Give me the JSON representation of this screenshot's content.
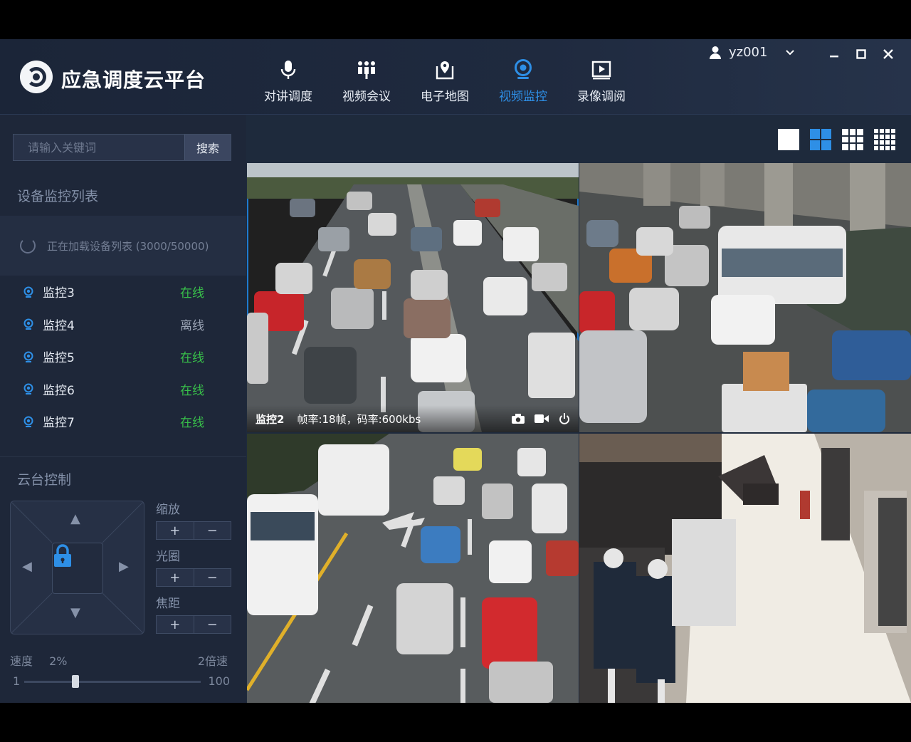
{
  "app": {
    "title": "应急调度云平台"
  },
  "nav": [
    {
      "label": "对讲调度",
      "icon": "microphone-icon",
      "active": false
    },
    {
      "label": "视频会议",
      "icon": "meeting-icon",
      "active": false
    },
    {
      "label": "电子地图",
      "icon": "map-pin-icon",
      "active": false
    },
    {
      "label": "视频监控",
      "icon": "camera-icon",
      "active": true
    },
    {
      "label": "录像调阅",
      "icon": "play-box-icon",
      "active": false
    }
  ],
  "user": {
    "name": "yz001"
  },
  "sidebar": {
    "search_placeholder": "请输入关键词",
    "search_button": "搜索",
    "device_list_title": "设备监控列表",
    "loading_text": "正在加载设备列表 (3000/50000)",
    "devices": [
      {
        "name": "监控3",
        "status": "在线"
      },
      {
        "name": "监控4",
        "status": "离线"
      },
      {
        "name": "监控5",
        "status": "在线"
      },
      {
        "name": "监控6",
        "status": "在线"
      },
      {
        "name": "监控7",
        "status": "在线"
      }
    ],
    "ptz_title": "云台控制",
    "zoom_label": "缩放",
    "iris_label": "光圈",
    "focus_label": "焦距",
    "plus": "+",
    "minus": "−",
    "speed_label": "速度",
    "speed_value": "2%",
    "speed_multiplier": "2倍速",
    "slider_min": "1",
    "slider_max": "100",
    "slider_fraction": 0.29
  },
  "video": {
    "active_camera": "监控2",
    "active_info": "帧率:18帧，码率:600kbs"
  },
  "colors": {
    "accent": "#2e8fe6",
    "online": "#38c04a",
    "offline": "#9aa3b4"
  }
}
